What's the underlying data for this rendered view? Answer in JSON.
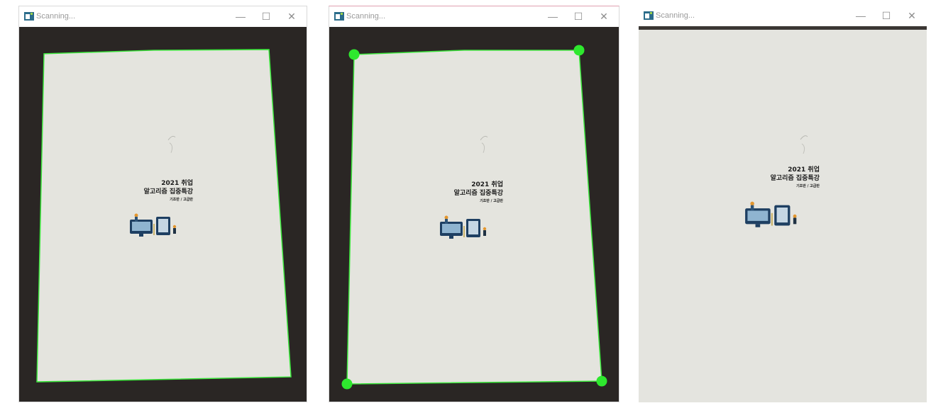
{
  "windows": [
    {
      "title": "Scanning...",
      "step": "contour"
    },
    {
      "title": "Scanning...",
      "step": "corners"
    },
    {
      "title": "Scanning...",
      "step": "warped"
    }
  ],
  "controls": {
    "minimize": "—",
    "maximize": "☐",
    "close": "✕"
  },
  "document": {
    "year_line": "2021 취업",
    "title_line": "알고리즘 집중특강",
    "level_line": "기초반 / 고급반"
  },
  "colors": {
    "desk": "#2a2624",
    "paper": "#e4e4de",
    "outline": "#3ce63c",
    "corner_marker": "#2ee82e",
    "window_icon": "#2b6c8a"
  },
  "icons": [
    "app-icon",
    "minimize-icon",
    "maximize-icon",
    "close-icon",
    "corner-marker"
  ]
}
